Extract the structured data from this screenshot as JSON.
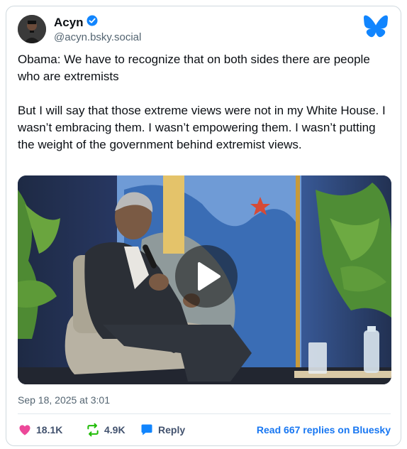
{
  "post": {
    "author_name": "Acyn",
    "author_handle": "@acyn.bsky.social",
    "text": "Obama: We have to recognize that on both sides there are people who are extremists\n\nBut I will say that those extreme views were not in my White House. I wasn’t embracing them. I wasn’t empowering them. I wasn’t putting the weight of the government behind extremist views.",
    "timestamp": "Sep 18, 2025 at 3:01",
    "verified_icon": "check-badge-icon",
    "logo_icon": "bluesky-butterfly-icon"
  },
  "media": {
    "type": "video",
    "play_icon": "play-icon"
  },
  "actions": {
    "likes": "18.1K",
    "reposts": "4.9K",
    "reply_label": "Reply",
    "read_replies": "Read 667 replies on Bluesky"
  },
  "colors": {
    "accent": "#1877f2",
    "like": "#ec4899",
    "repost": "#20bc07",
    "reply": "#1185fe",
    "muted": "#536471"
  }
}
